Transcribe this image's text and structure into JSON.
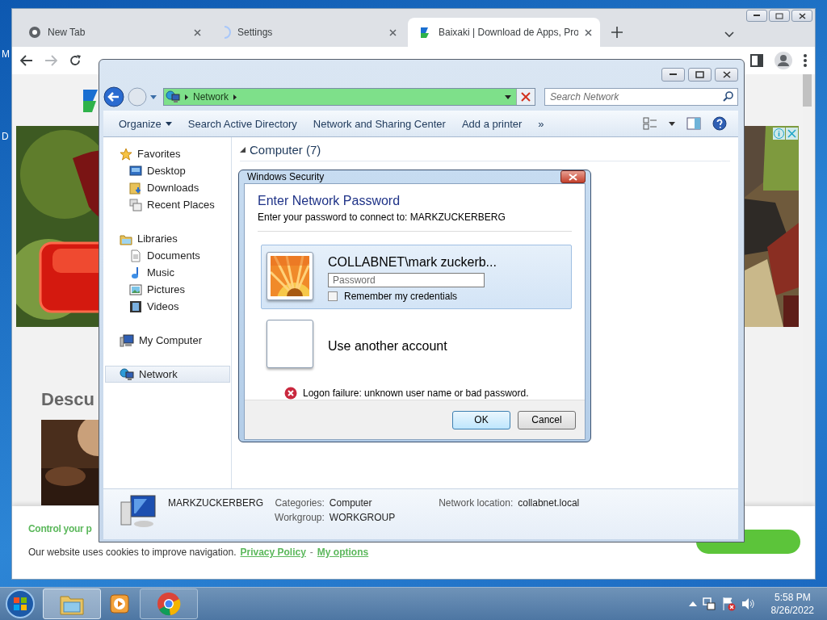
{
  "desktop": {
    "icon_labels": [
      "M",
      "D"
    ]
  },
  "browser": {
    "tabs": [
      {
        "title": "New Tab",
        "kind": "newtab",
        "selected": false
      },
      {
        "title": "Settings",
        "kind": "loading",
        "selected": false
      },
      {
        "title": "Baixaki | Download de Apps, Pro",
        "kind": "site",
        "selected": true
      }
    ],
    "page": {
      "heading": "Descu",
      "cookie_banner": {
        "title": "Control your p",
        "text": "Our website uses cookies to improve navigation.",
        "links": [
          "Privacy Policy",
          "My options"
        ],
        "separator": "-"
      }
    }
  },
  "explorer": {
    "address": "Network",
    "search": {
      "placeholder": "Search Network"
    },
    "toolbar": [
      {
        "label": "Organize",
        "kind": "menu"
      },
      {
        "label": "Search Active Directory",
        "kind": "button"
      },
      {
        "label": "Network and Sharing Center",
        "kind": "button"
      },
      {
        "label": "Add a printer",
        "kind": "button"
      },
      {
        "label": "»",
        "kind": "button"
      }
    ],
    "sidebar": [
      {
        "label": "Favorites",
        "kind": "star",
        "selected": false,
        "children": [
          {
            "label": "Desktop",
            "kind": "desktop",
            "selected": false
          },
          {
            "label": "Downloads",
            "kind": "downloads",
            "selected": false
          },
          {
            "label": "Recent Places",
            "kind": "recent",
            "selected": false
          }
        ]
      },
      {
        "label": "Libraries",
        "kind": "libraries",
        "selected": false,
        "children": [
          {
            "label": "Documents",
            "kind": "documents",
            "selected": false
          },
          {
            "label": "Music",
            "kind": "music",
            "selected": false
          },
          {
            "label": "Pictures",
            "kind": "pictures",
            "selected": false
          },
          {
            "label": "Videos",
            "kind": "videos",
            "selected": false
          }
        ]
      },
      {
        "label": "My Computer",
        "kind": "computer",
        "selected": false
      },
      {
        "label": "Network",
        "kind": "network",
        "selected": true
      }
    ],
    "group": {
      "title": "Computer (7)",
      "expanded": true
    },
    "details": {
      "name": "MARKZUCKERBERG",
      "columns": [
        [
          {
            "label": "Categories:",
            "value": "Computer"
          },
          {
            "label": "Workgroup:",
            "value": "WORKGROUP"
          }
        ],
        [
          {
            "label": "Network location:",
            "value": "collabnet.local"
          }
        ]
      ]
    }
  },
  "dialog": {
    "title": "Windows Security",
    "heading": "Enter Network Password",
    "subtitle": "Enter your password to connect to: MARKZUCKERBERG",
    "accounts": [
      {
        "kind": "user",
        "name": "COLLABNET\\mark zuckerb...",
        "selected": true,
        "password": {
          "placeholder": "Password"
        },
        "remember": {
          "label": "Remember my credentials",
          "checked": false
        }
      },
      {
        "kind": "other",
        "name": "Use another account",
        "selected": false
      }
    ],
    "error": "Logon failure: unknown user name or bad password.",
    "buttons": [
      {
        "label": "OK",
        "default": true
      },
      {
        "label": "Cancel",
        "default": false
      }
    ]
  },
  "taskbar": {
    "apps": [
      {
        "kind": "explorer",
        "selected": true,
        "running": true
      },
      {
        "kind": "media",
        "selected": false,
        "running": false
      },
      {
        "kind": "chrome",
        "selected": false,
        "running": true
      }
    ],
    "time": "5:58 PM",
    "date": "8/26/2022"
  }
}
